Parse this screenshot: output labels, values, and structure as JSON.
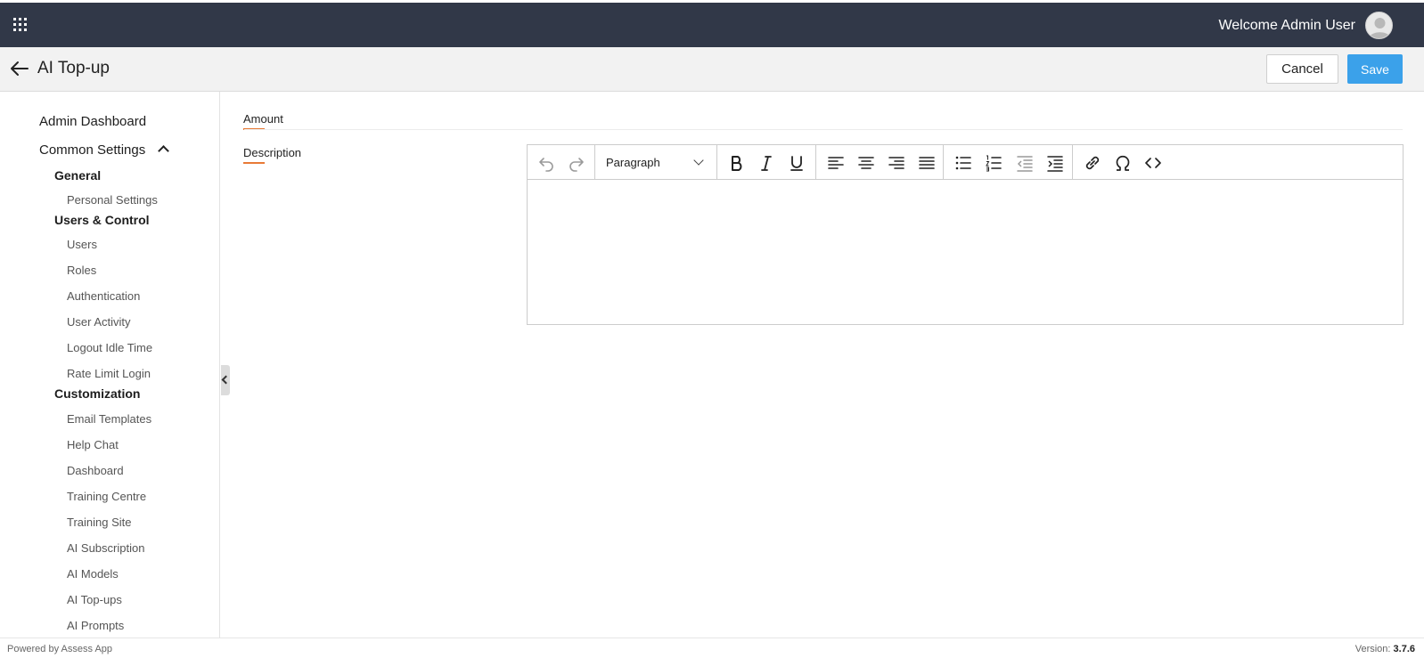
{
  "header": {
    "welcome_text": "Welcome Admin User",
    "icons": {
      "apps": "apps-grid-icon",
      "avatar": "user-avatar-icon"
    }
  },
  "page": {
    "title": "AI Top-up",
    "cancel_label": "Cancel",
    "save_label": "Save"
  },
  "sidebar": {
    "admin_dashboard": "Admin Dashboard",
    "common_settings": "Common Settings",
    "general": "General",
    "personal_settings": "Personal Settings",
    "users_control": "Users & Control",
    "users": "Users",
    "roles": "Roles",
    "authentication": "Authentication",
    "user_activity": "User Activity",
    "logout_idle_time": "Logout Idle Time",
    "rate_limit_login": "Rate Limit Login",
    "customization": "Customization",
    "email_templates": "Email Templates",
    "help_chat": "Help Chat",
    "dashboard": "Dashboard",
    "training_centre": "Training Centre",
    "training_site": "Training Site",
    "ai_subscription": "AI Subscription",
    "ai_models": "AI Models",
    "ai_topups": "AI Top-ups",
    "ai_prompts": "AI Prompts"
  },
  "form": {
    "amount_label": "Amount",
    "description_label": "Description",
    "editor": {
      "block_format": "Paragraph"
    }
  },
  "footer": {
    "powered_by": "Powered by Assess App",
    "version_label": "Version:",
    "version_value": "3.7.6"
  },
  "colors": {
    "topbar": "#313848",
    "save_button": "#3ba1ea",
    "label_accent": "#e87a36"
  }
}
